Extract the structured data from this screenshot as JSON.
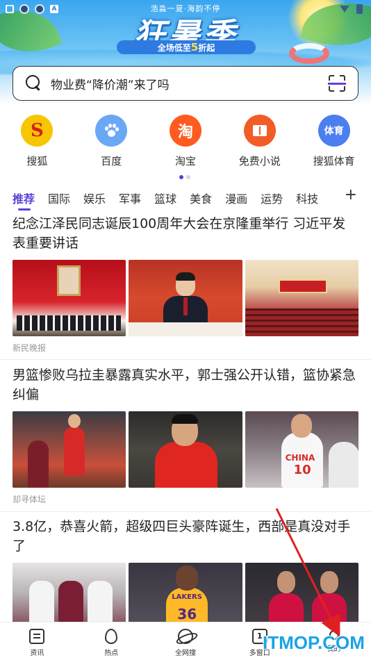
{
  "banner": {
    "top_text": "浩淼一夏·海韵不停",
    "title": "狂暑季",
    "subtitle_prefix": "全场低至",
    "subtitle_highlight": "5",
    "subtitle_suffix": "折起"
  },
  "status_bar": {
    "left_icons": [
      "app-icon",
      "shield-icon",
      "shield-icon",
      "a-icon"
    ],
    "right_icons": [
      "wifi-icon",
      "battery-icon"
    ]
  },
  "search": {
    "placeholder": "物业费“降价潮”来了吗"
  },
  "shortcuts": [
    {
      "label": "搜狐",
      "icon": "sohu-logo-icon",
      "glyph": "S",
      "color": "#f7c600"
    },
    {
      "label": "百度",
      "icon": "baidu-paw-icon",
      "glyph": "",
      "color": "#6aa7f5"
    },
    {
      "label": "淘宝",
      "icon": "taobao-icon",
      "glyph": "淘",
      "color": "#ff5a1f"
    },
    {
      "label": "免费小说",
      "icon": "book-icon",
      "glyph": "",
      "color": "#f25c26"
    },
    {
      "label": "搜狐体育",
      "icon": "sohu-sports-icon",
      "glyph": "体育",
      "color": "#4b7ff0"
    }
  ],
  "tabs": [
    "推荐",
    "国际",
    "娱乐",
    "军事",
    "篮球",
    "美食",
    "漫画",
    "运势",
    "科技"
  ],
  "tab_add": "+",
  "articles": [
    {
      "title": "纪念江泽民同志诞辰100周年大会在京隆重举行 习近平发表重要讲话",
      "source": "新民晚报"
    },
    {
      "title": "男篮惨败乌拉圭暴露真实水平，郭士强公开认错，篮协紧急纠偏",
      "source": "却寻体坛"
    },
    {
      "title": "3.8亿，恭喜火箭，超级四巨头豪阵诞生，西部是真没对手了",
      "source": ""
    }
  ],
  "image_texts": {
    "china_jersey": "CHINA",
    "china_number": "10",
    "lakers_text": "LAKERS",
    "lakers_number": "36"
  },
  "bottom_nav": [
    {
      "label": "资讯",
      "icon": "news-icon"
    },
    {
      "label": "热点",
      "icon": "fire-icon"
    },
    {
      "label": "全网搜",
      "icon": "globe-icon"
    },
    {
      "label": "多窗口",
      "icon": "windows-icon",
      "badge": "1"
    },
    {
      "label": "我的",
      "icon": "profile-icon"
    }
  ],
  "watermark": "ITMOP.COM",
  "colors": {
    "accent": "#5a3fd8",
    "annotation_arrow": "#e02020",
    "watermark": "#1aa3e8"
  }
}
